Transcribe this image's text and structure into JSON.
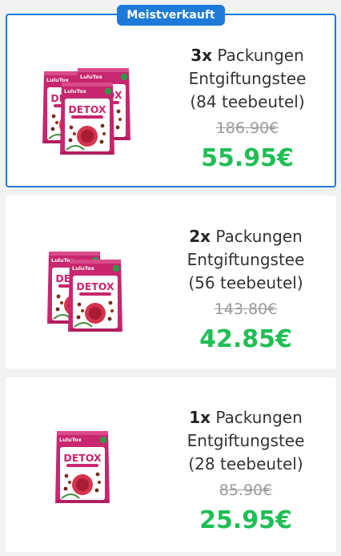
{
  "badge": "Meistverkauft",
  "offers": [
    {
      "qty": "3x",
      "qty_word": "Packungen",
      "product": "Entgiftungstee",
      "bags": "(84 teebeutel)",
      "old_price": "186.90€",
      "price": "55.95€",
      "featured": true
    },
    {
      "qty": "2x",
      "qty_word": "Packungen",
      "product": "Entgiftungstee",
      "bags": "(56 teebeutel)",
      "old_price": "143.80€",
      "price": "42.85€",
      "featured": false
    },
    {
      "qty": "1x",
      "qty_word": "Packungen",
      "product": "Entgiftungstee",
      "bags": "(28 teebeutel)",
      "old_price": "85.90€",
      "price": "25.95€",
      "featured": false
    }
  ],
  "pack": {
    "brand": "LuluTox",
    "name": "DETOX"
  },
  "colors": {
    "accent": "#1e7ad8",
    "price": "#1fbf54",
    "pack": "#c8266e"
  }
}
